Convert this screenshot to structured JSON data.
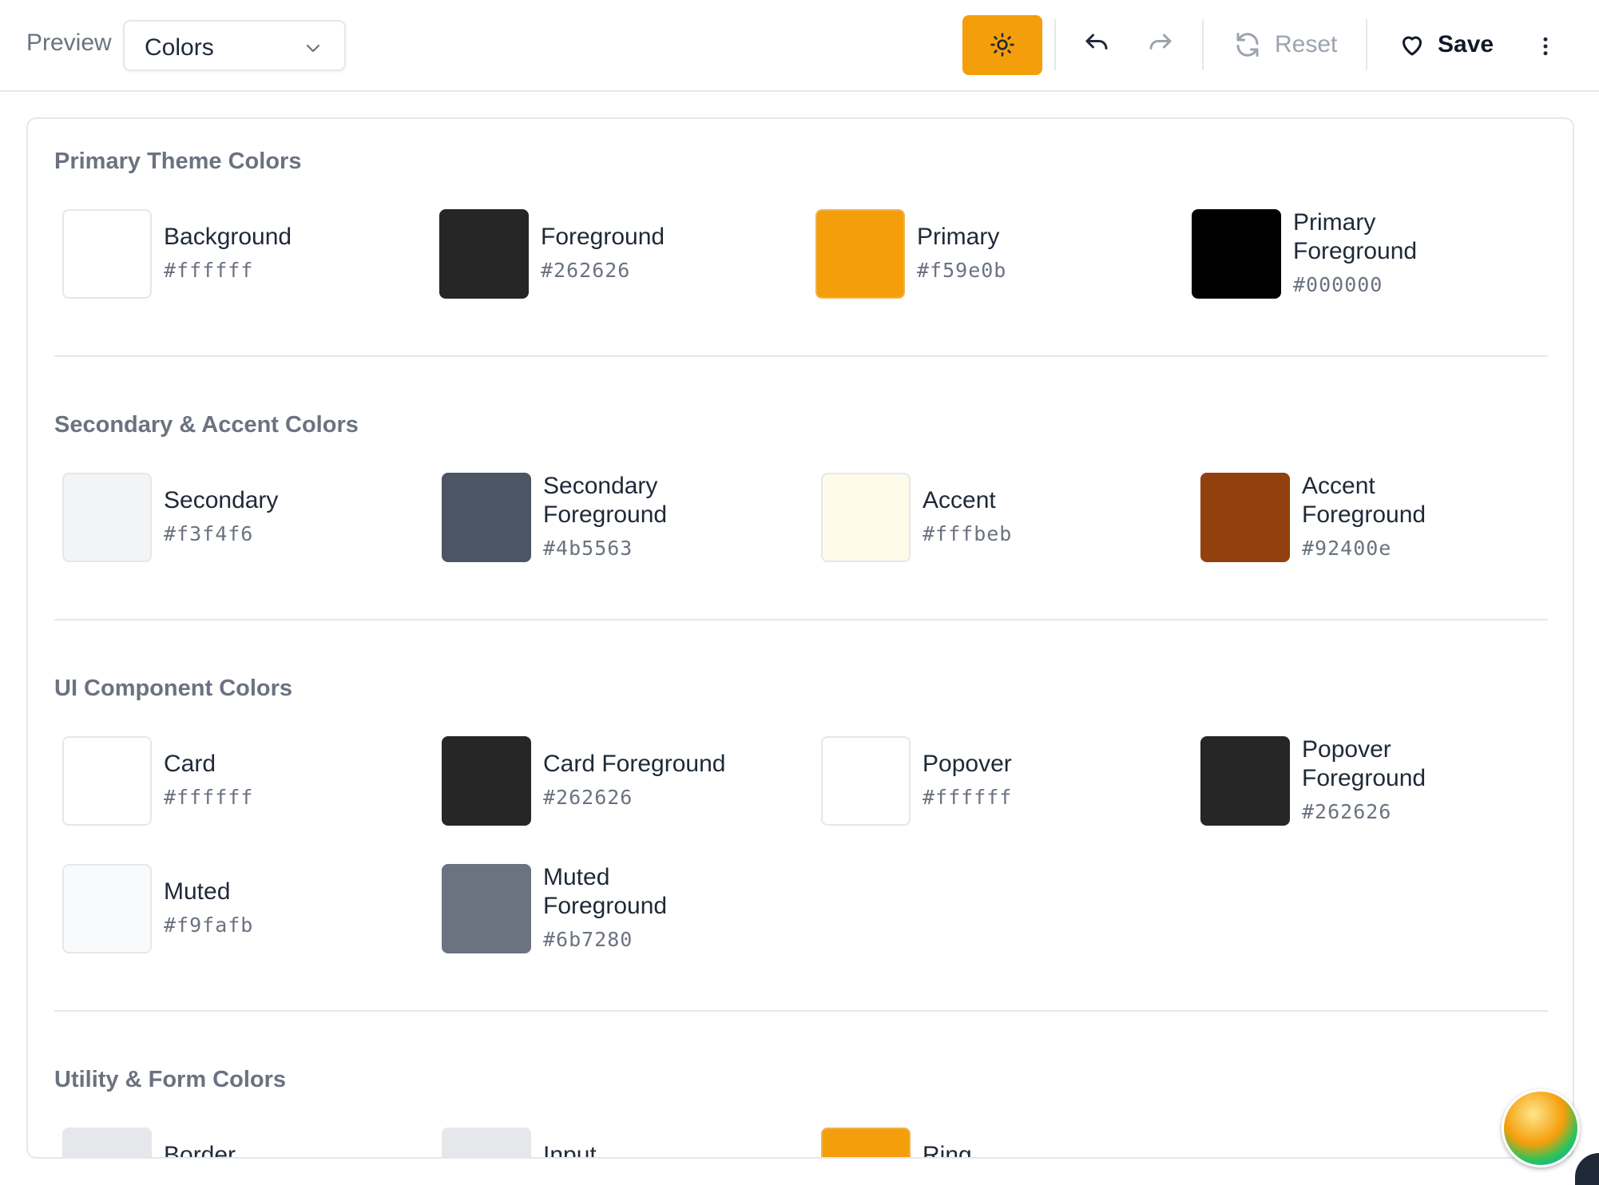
{
  "toolbar": {
    "preview_label": "Preview",
    "select_value": "Colors",
    "reset_label": "Reset",
    "save_label": "Save",
    "theme_button_color": "#f59e0b"
  },
  "sections": [
    {
      "title": "Primary Theme Colors",
      "colors": [
        {
          "name": "Background",
          "hex": "#ffffff"
        },
        {
          "name": "Foreground",
          "hex": "#262626"
        },
        {
          "name": "Primary",
          "hex": "#f59e0b"
        },
        {
          "name": "Primary Foreground",
          "hex": "#000000"
        }
      ]
    },
    {
      "title": "Secondary & Accent Colors",
      "colors": [
        {
          "name": "Secondary",
          "hex": "#f3f4f6"
        },
        {
          "name": "Secondary Foreground",
          "hex": "#4b5563"
        },
        {
          "name": "Accent",
          "hex": "#fffbeb"
        },
        {
          "name": "Accent Foreground",
          "hex": "#92400e"
        }
      ]
    },
    {
      "title": "UI Component Colors",
      "colors": [
        {
          "name": "Card",
          "hex": "#ffffff"
        },
        {
          "name": "Card Foreground",
          "hex": "#262626"
        },
        {
          "name": "Popover",
          "hex": "#ffffff"
        },
        {
          "name": "Popover Foreground",
          "hex": "#262626"
        },
        {
          "name": "Muted",
          "hex": "#f9fafb"
        },
        {
          "name": "Muted Foreground",
          "hex": "#6b7280"
        }
      ]
    },
    {
      "title": "Utility & Form Colors",
      "colors": [
        {
          "name": "Border",
          "hex": "#e5e7eb"
        },
        {
          "name": "Input",
          "hex": "#e5e7eb"
        },
        {
          "name": "Ring",
          "hex": "#f59e0b"
        }
      ]
    }
  ],
  "icons": {
    "theme": "sun-icon",
    "undo": "undo-icon",
    "redo": "redo-icon",
    "reset": "refresh-icon",
    "save": "heart-icon",
    "more": "more-vertical-icon",
    "select": "chevron-down-icon"
  }
}
